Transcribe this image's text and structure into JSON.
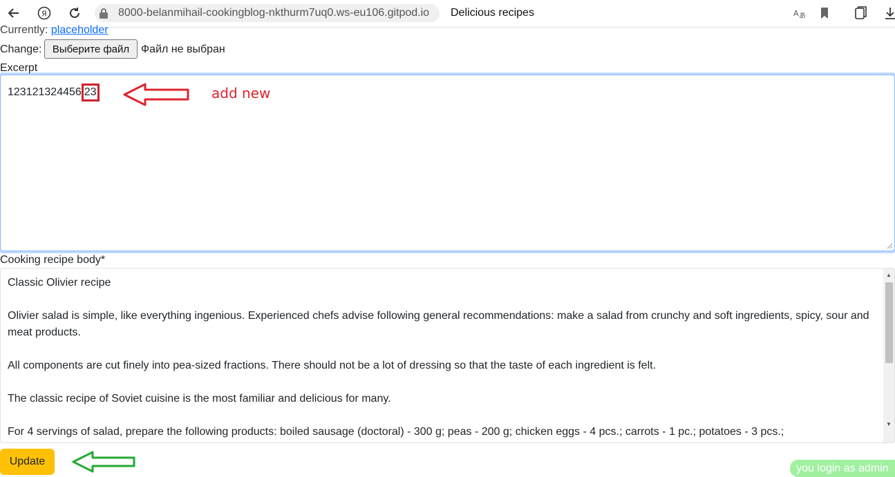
{
  "browser": {
    "url": "8000-belanmihail-cookingblog-nkthurm7uq0.ws-eu106.gitpod.io",
    "page_title": "Delicious recipes",
    "icons": [
      "back-arrow-icon",
      "yandex-icon",
      "reload-icon",
      "lock-icon",
      "translate-icon",
      "bookmark-icon",
      "collections-icon",
      "download-icon"
    ]
  },
  "form": {
    "currently_label": "Currently:",
    "currently_value": "placeholder",
    "change_label": "Change:",
    "file_button": "Выберите файл",
    "file_status": "Файл не выбран",
    "excerpt_label": "Excerpt",
    "excerpt_value_main": "123121324456",
    "excerpt_value_new": "23",
    "body_label": "Cooking recipe body*",
    "body_paragraphs": [
      "Classic Olivier recipe",
      "Olivier salad is simple, like everything ingenious. Experienced chefs advise following general recommendations: make a salad from crunchy and soft ingredients, spicy, sour and meat products.",
      "All components are cut finely into pea-sized fractions. There should not be a lot of dressing so that the taste of each ingredient is felt.",
      "The classic recipe of Soviet cuisine is the most familiar and delicious for many.",
      "For 4 servings of salad, prepare the following products: boiled sausage (doctoral) - 300 g; peas - 200 g; chicken eggs - 4 pcs.; carrots - 1 pc.; potatoes - 3 pcs.;"
    ],
    "update_button": "Update"
  },
  "annotations": {
    "add_new": "add new"
  },
  "status": {
    "login_badge": "you login as admin"
  },
  "colors": {
    "update_button": "#ffc107",
    "annotation_red": "#e0242d",
    "annotation_green": "#22aa33",
    "badge_green": "#90ee90"
  }
}
